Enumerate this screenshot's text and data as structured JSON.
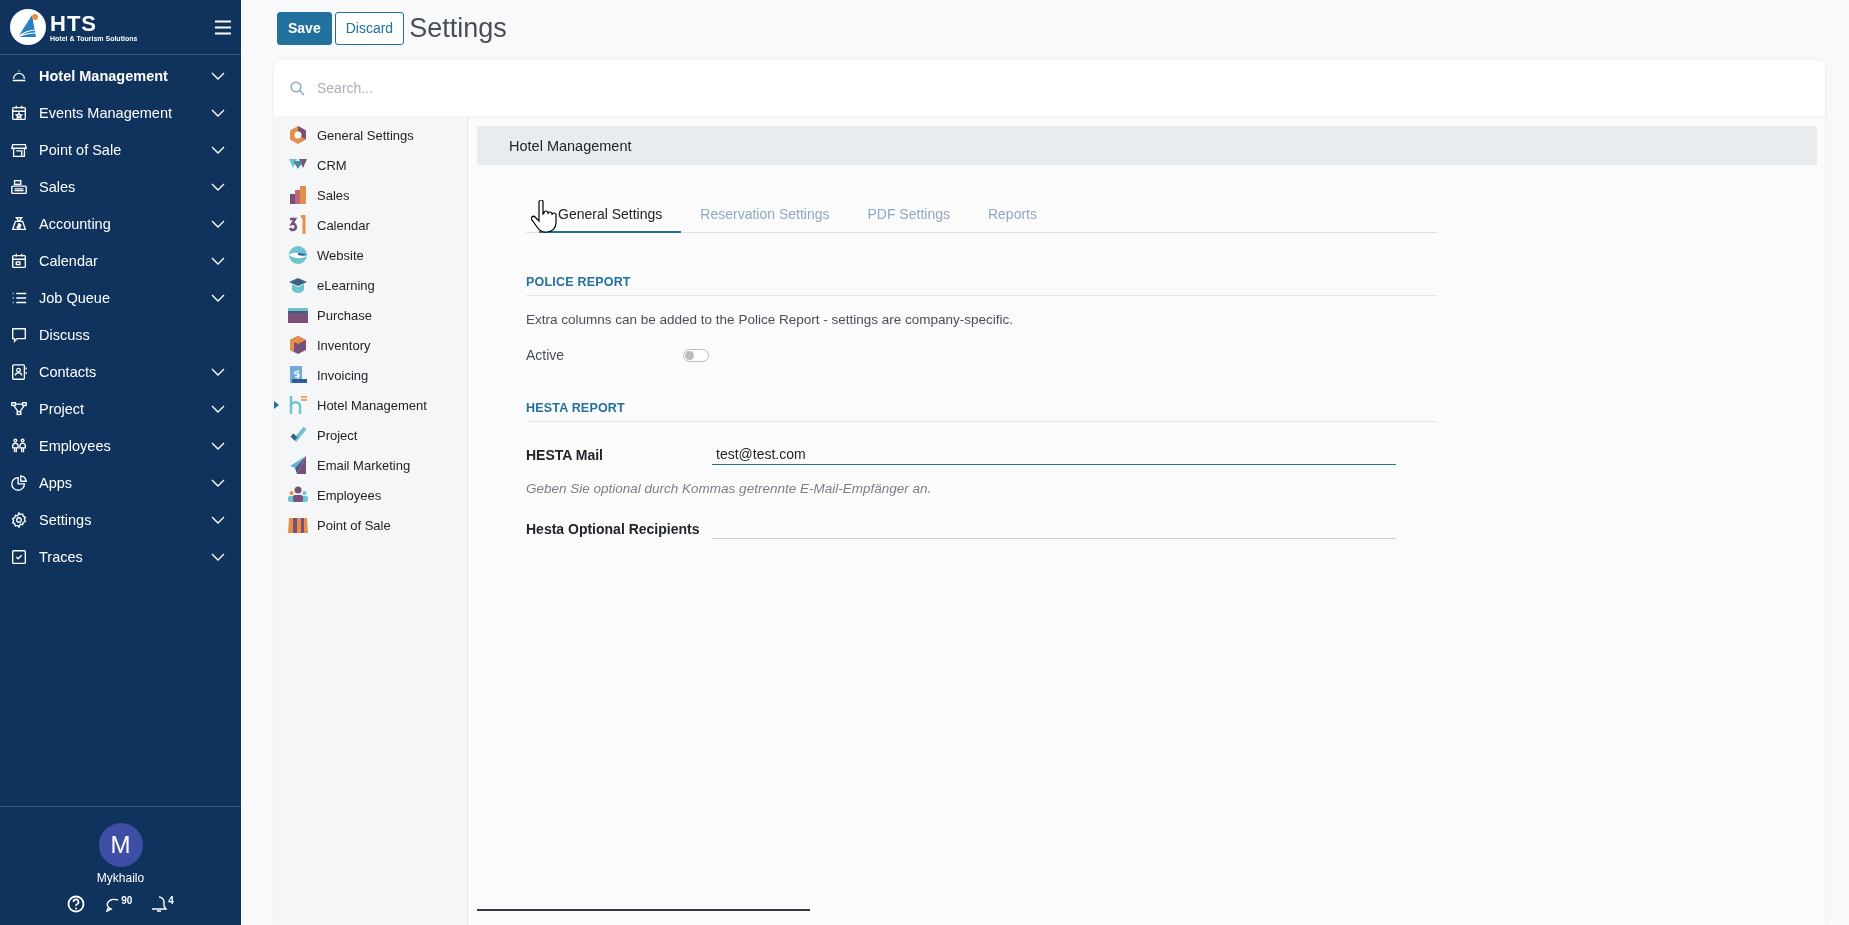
{
  "sidebar": {
    "logo": {
      "name": "HTS",
      "tagline": "Hotel & Tourism Solutions"
    },
    "items": [
      {
        "label": "Hotel Management",
        "expandable": true,
        "selected": true
      },
      {
        "label": "Events Management",
        "expandable": true,
        "selected": false
      },
      {
        "label": "Point of Sale",
        "expandable": true,
        "selected": false
      },
      {
        "label": "Sales",
        "expandable": true,
        "selected": false
      },
      {
        "label": "Accounting",
        "expandable": true,
        "selected": false
      },
      {
        "label": "Calendar",
        "expandable": true,
        "selected": false
      },
      {
        "label": "Job Queue",
        "expandable": true,
        "selected": false
      },
      {
        "label": "Discuss",
        "expandable": false,
        "selected": false
      },
      {
        "label": "Contacts",
        "expandable": true,
        "selected": false
      },
      {
        "label": "Project",
        "expandable": true,
        "selected": false
      },
      {
        "label": "Employees",
        "expandable": true,
        "selected": false
      },
      {
        "label": "Apps",
        "expandable": true,
        "selected": false
      },
      {
        "label": "Settings",
        "expandable": true,
        "selected": false
      },
      {
        "label": "Traces",
        "expandable": true,
        "selected": false
      }
    ],
    "user": {
      "initial": "M",
      "name": "Mykhailo"
    },
    "counters": {
      "messages": "90",
      "notifications": "4"
    }
  },
  "header": {
    "buttons": [
      {
        "label": "Save",
        "kind": "primary"
      },
      {
        "label": "Discard",
        "kind": "secondary"
      }
    ],
    "title": "Settings"
  },
  "search": {
    "placeholder": "Search..."
  },
  "apps": [
    {
      "label": "General Settings",
      "selected": false
    },
    {
      "label": "CRM",
      "selected": false
    },
    {
      "label": "Sales",
      "selected": false
    },
    {
      "label": "Calendar",
      "selected": false
    },
    {
      "label": "Website",
      "selected": false
    },
    {
      "label": "eLearning",
      "selected": false
    },
    {
      "label": "Purchase",
      "selected": false
    },
    {
      "label": "Inventory",
      "selected": false
    },
    {
      "label": "Invoicing",
      "selected": false
    },
    {
      "label": "Hotel Management",
      "selected": true
    },
    {
      "label": "Project",
      "selected": false
    },
    {
      "label": "Email Marketing",
      "selected": false
    },
    {
      "label": "Employees",
      "selected": false
    },
    {
      "label": "Point of Sale",
      "selected": false
    }
  ],
  "panel": {
    "title": "Hotel Management",
    "tabs": [
      {
        "label": "General Settings",
        "selected": true
      },
      {
        "label": "Reservation Settings",
        "selected": false
      },
      {
        "label": "PDF Settings",
        "selected": false
      },
      {
        "label": "Reports",
        "selected": false
      }
    ],
    "sections": [
      {
        "title": "POLICE REPORT",
        "rows": [
          {
            "kind": "note",
            "text": "Extra columns can be added to the Police Report - settings are company-specific."
          },
          {
            "kind": "toggle",
            "label": "Active",
            "on": false
          }
        ]
      },
      {
        "title": "HESTA REPORT",
        "rows": [
          {
            "kind": "field",
            "label": "HESTA Mail",
            "value": "test@test.com",
            "focused": true
          },
          {
            "kind": "hint",
            "text": "Geben Sie optional durch Kommas getrennte E-Mail-Empfänger an."
          },
          {
            "kind": "field",
            "label": "Hesta Optional Recipients",
            "focused": false
          }
        ]
      }
    ]
  }
}
